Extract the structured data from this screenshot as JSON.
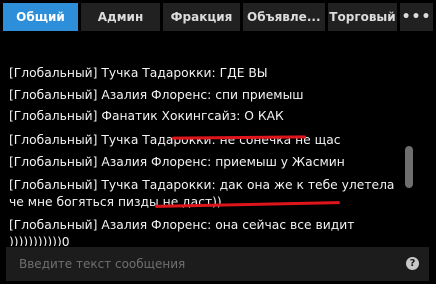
{
  "tabs": [
    {
      "label": "Общий",
      "active": true
    },
    {
      "label": "Админ",
      "active": false
    },
    {
      "label": "Фракция",
      "active": false
    },
    {
      "label": "Объявле...",
      "active": false
    },
    {
      "label": "Торговый",
      "active": false
    },
    {
      "label": "•••",
      "active": false
    }
  ],
  "messages": [
    "[Глобальный] Тучка Тадарокки: ГДЕ ВЫ",
    "[Глобальный] Азалия Флоренс: спи приемыш",
    "[Глобальный] Фанатик Хокингсайз: О КАК",
    "[Глобальный] Тучка Тадарокки: не сонечка не щас",
    "[Глобальный] Азалия Флоренс: приемыш у Жасмин",
    "[Глобальный] Тучка Тадарокки: дак она же к тебе улетела\nче мне богяться пизды не даст))",
    "[Глобальный] Азалия Флоренс: она сейчас все видит\n)))))))))))0"
  ],
  "input": {
    "placeholder": "Введите текст сообщения",
    "value": ""
  },
  "help_icon": "?",
  "colors": {
    "accent": "#2d8fda",
    "tab_bg": "#212121",
    "underline": "#e0141b",
    "background": "#000000"
  }
}
